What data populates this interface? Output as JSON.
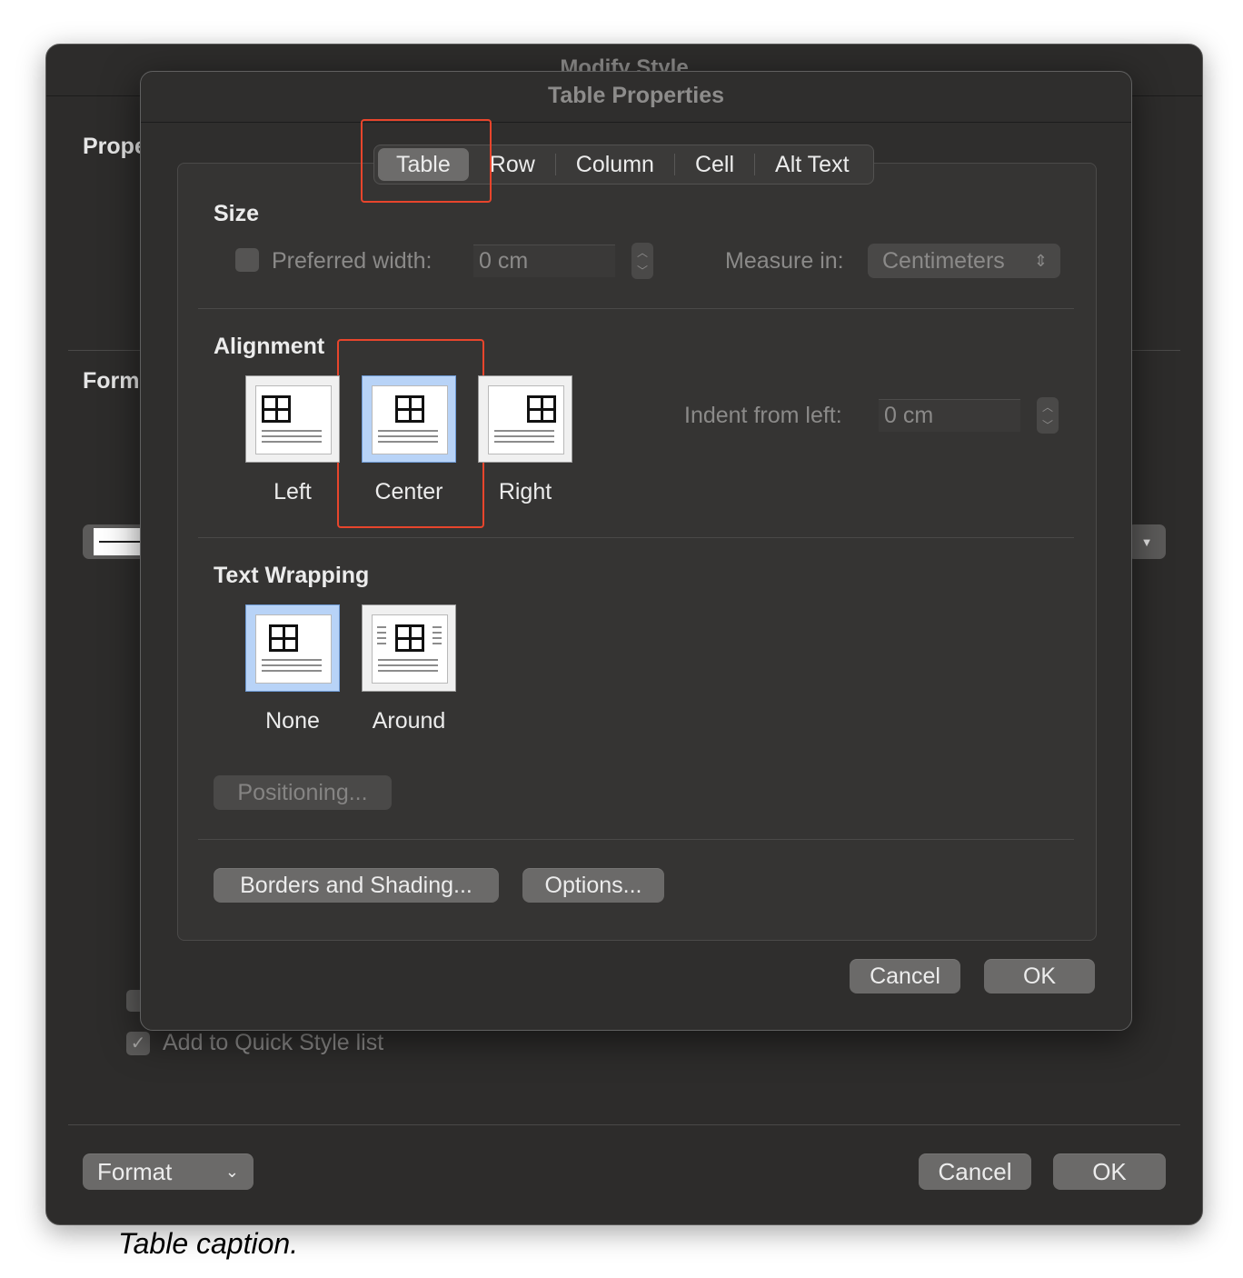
{
  "background_window": {
    "title": "Modify Style",
    "properties_label": "Prope",
    "formatting_label": "Form",
    "add_quick_style_label": "Add to Quick Style list",
    "format_button": "Format",
    "cancel_button": "Cancel",
    "ok_button": "OK"
  },
  "dialog": {
    "title": "Table Properties",
    "tabs": [
      "Table",
      "Row",
      "Column",
      "Cell",
      "Alt Text"
    ],
    "active_tab": "Table",
    "size": {
      "heading": "Size",
      "preferred_width_label": "Preferred width:",
      "preferred_width_value": "0 cm",
      "measure_in_label": "Measure in:",
      "measure_in_value": "Centimeters"
    },
    "alignment": {
      "heading": "Alignment",
      "options": [
        "Left",
        "Center",
        "Right"
      ],
      "selected": "Center",
      "indent_label": "Indent from left:",
      "indent_value": "0 cm"
    },
    "wrapping": {
      "heading": "Text Wrapping",
      "options": [
        "None",
        "Around"
      ],
      "selected": "None",
      "positioning_button": "Positioning..."
    },
    "borders_button": "Borders and Shading...",
    "options_button": "Options...",
    "cancel_button": "Cancel",
    "ok_button": "OK"
  },
  "caption": "Table caption.",
  "colors": {
    "highlight": "#e8452c",
    "selected_tile": "#b8d3f7",
    "dialog_bg": "#2f2e2d"
  }
}
